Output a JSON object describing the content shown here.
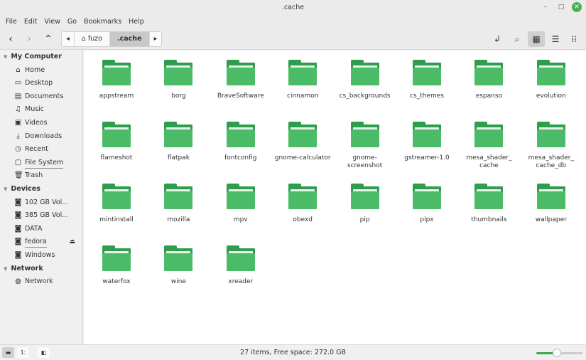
{
  "window": {
    "title": ".cache",
    "minimize": "–",
    "maximize": "□",
    "close": "✕"
  },
  "menu": [
    "File",
    "Edit",
    "View",
    "Go",
    "Bookmarks",
    "Help"
  ],
  "toolbar": {
    "back": "‹",
    "forward": "›",
    "up": "⌃",
    "crumb_left": "◂",
    "crumb_right": "▸",
    "crumbs": [
      "fuzo",
      ".cache"
    ]
  },
  "sidebar": {
    "sections": [
      {
        "title": "My Computer",
        "items": [
          {
            "label": "Home",
            "icon": "⌂"
          },
          {
            "label": "Desktop",
            "icon": "▭"
          },
          {
            "label": "Documents",
            "icon": "▤"
          },
          {
            "label": "Music",
            "icon": "♫"
          },
          {
            "label": "Videos",
            "icon": "▣"
          },
          {
            "label": "Downloads",
            "icon": "⤓"
          },
          {
            "label": "Recent",
            "icon": "◷"
          },
          {
            "label": "File System",
            "icon": "▢"
          },
          {
            "label": "Trash",
            "icon": "🗑"
          }
        ]
      },
      {
        "title": "Devices",
        "items": [
          {
            "label": "102 GB Vol...",
            "icon": "◙"
          },
          {
            "label": "385 GB Vol...",
            "icon": "◙"
          },
          {
            "label": "DATA",
            "icon": "◙"
          },
          {
            "label": "fedora",
            "icon": "◙"
          },
          {
            "label": "Windows",
            "icon": "◙"
          }
        ]
      },
      {
        "title": "Network",
        "items": [
          {
            "label": "Network",
            "icon": "◍"
          }
        ]
      }
    ],
    "eject": "⏏"
  },
  "folders": [
    "appstream",
    "borg",
    "BraveSoftware",
    "cinnamon",
    "cs_backgrounds",
    "cs_themes",
    "espanso",
    "evolution",
    "flameshot",
    "flatpak",
    "fontconfig",
    "gnome-calculator",
    "gnome-screenshot",
    "gstreamer-1.0",
    "mesa_shader_cache",
    "mesa_shader_cache_db",
    "mintinstall",
    "mozilla",
    "mpv",
    "obexd",
    "pip",
    "pipx",
    "thumbnails",
    "wallpaper",
    "waterfox",
    "wine",
    "xreader"
  ],
  "status": {
    "text": "27 items, Free space: 272.0 GB",
    "zoom_level": 0.45
  },
  "colors": {
    "folder": "#4cbb68",
    "folder_dark": "#2e9d4d",
    "accent": "#3ea84f"
  }
}
